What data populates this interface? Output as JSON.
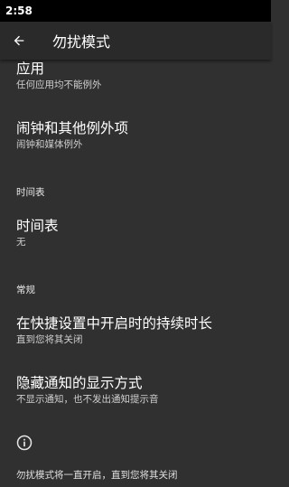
{
  "status_bar": {
    "time": "2:58"
  },
  "app_bar": {
    "title": "勿扰模式",
    "back_icon": "arrow-back-icon"
  },
  "prefs": {
    "apps": {
      "title": "应用",
      "summary": "任何应用均不能例外"
    },
    "alarms": {
      "title": "闹钟和其他例外项",
      "summary": "闹钟和媒体例外"
    },
    "schedules": {
      "title": "时间表",
      "summary": "无"
    },
    "duration": {
      "title": "在快捷设置中开启时的持续时长",
      "summary": "直到您将其关闭"
    },
    "hide_notifications": {
      "title": "隐藏通知的显示方式",
      "summary": "不显示通知，也不发出通知提示音"
    }
  },
  "categories": {
    "schedule": "时间表",
    "general": "常规"
  },
  "footer": {
    "info_icon": "info-icon",
    "text": "勿扰模式将一直开启，直到您将其关闭"
  }
}
